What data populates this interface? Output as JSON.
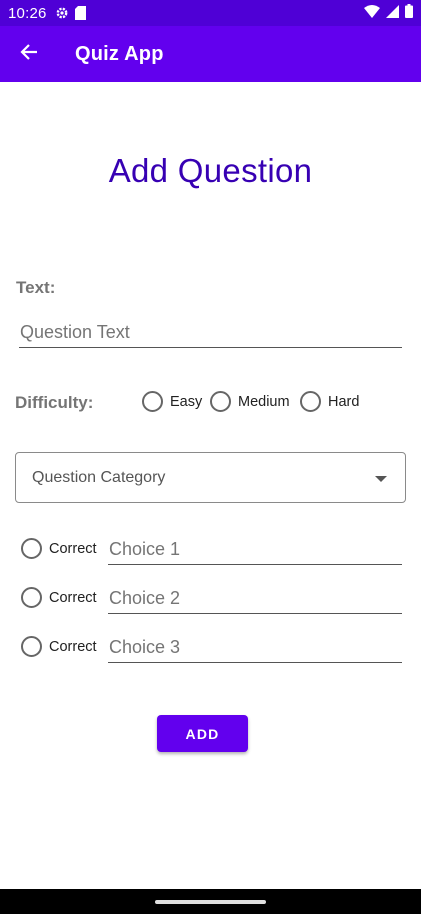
{
  "status_bar": {
    "time": "10:26",
    "left_icons": [
      "settings-icon",
      "sd-card-icon"
    ],
    "right_icons": [
      "wifi-icon",
      "signal-icon",
      "battery-icon"
    ]
  },
  "app_bar": {
    "title": "Quiz App",
    "back_icon": "arrow-back-icon",
    "color": "#6200ee"
  },
  "heading": "Add Question",
  "text_field": {
    "label": "Text:",
    "placeholder": "Question Text",
    "value": ""
  },
  "difficulty": {
    "label": "Difficulty:",
    "options": [
      "Easy",
      "Medium",
      "Hard"
    ],
    "selected": null
  },
  "category": {
    "placeholder": "Question Category",
    "icon": "dropdown-arrow-icon"
  },
  "choices": [
    {
      "correct_label": "Correct",
      "placeholder": "Choice 1",
      "value": ""
    },
    {
      "correct_label": "Correct",
      "placeholder": "Choice 2",
      "value": ""
    },
    {
      "correct_label": "Correct",
      "placeholder": "Choice 3",
      "value": ""
    }
  ],
  "add_button": "ADD",
  "colors": {
    "primary": "#6200ee",
    "status_bar": "#4f00d6",
    "heading": "#3700b3"
  }
}
